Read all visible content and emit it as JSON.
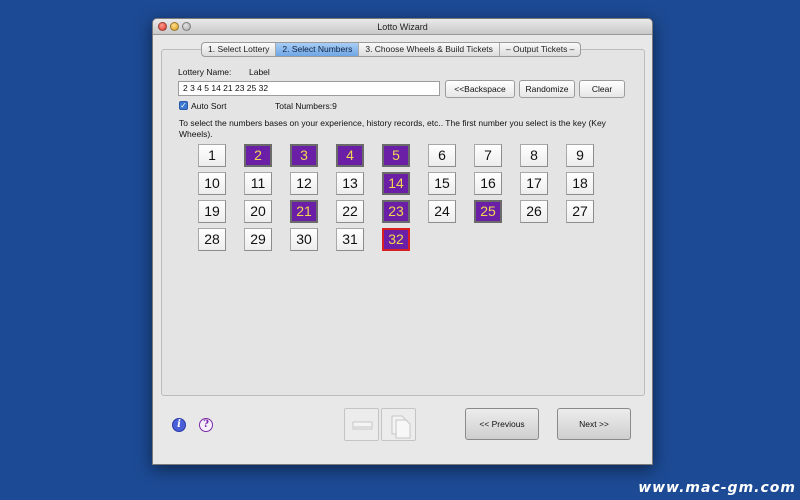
{
  "window": {
    "title": "Lotto Wizard"
  },
  "tabs": [
    {
      "label": "1. Select Lottery",
      "active": false
    },
    {
      "label": "2. Select Numbers",
      "active": true
    },
    {
      "label": "3. Choose Wheels & Build Tickets",
      "active": false
    },
    {
      "label": "– Output Tickets –",
      "active": false
    }
  ],
  "lottery": {
    "name_label": "Lottery Name:",
    "name_value": "Label"
  },
  "numbers_field": {
    "value": "2 3 4 5 14 21 23 25 32"
  },
  "buttons": {
    "backspace": "<<Backspace",
    "randomize": "Randomize",
    "clear": "Clear"
  },
  "auto_sort": {
    "label": "Auto Sort",
    "checked": true
  },
  "total": {
    "label": "Total Numbers:9"
  },
  "hint": "To select the numbers bases on your experience, history records, etc.. The first number you select is the key (Key Wheels).",
  "number_grid": {
    "numbers": [
      "1",
      "2",
      "3",
      "4",
      "5",
      "6",
      "7",
      "8",
      "9",
      "10",
      "11",
      "12",
      "13",
      "14",
      "15",
      "16",
      "17",
      "18",
      "19",
      "20",
      "21",
      "22",
      "23",
      "24",
      "25",
      "26",
      "27",
      "28",
      "29",
      "30",
      "31",
      "32"
    ],
    "selected": [
      "2",
      "3",
      "4",
      "5",
      "14",
      "21",
      "23",
      "25",
      "32"
    ],
    "last_selected": "32",
    "selected_color": "#6a1fa6",
    "selected_text_color": "#f0d850"
  },
  "icons": {
    "info": "i",
    "help": "?"
  },
  "nav": {
    "previous": "<< Previous",
    "next": "Next >>"
  },
  "watermark": "www.mac-gm.com",
  "colors": {
    "desktop": "#1c4a94",
    "tab_active": "#6fa6e6"
  }
}
